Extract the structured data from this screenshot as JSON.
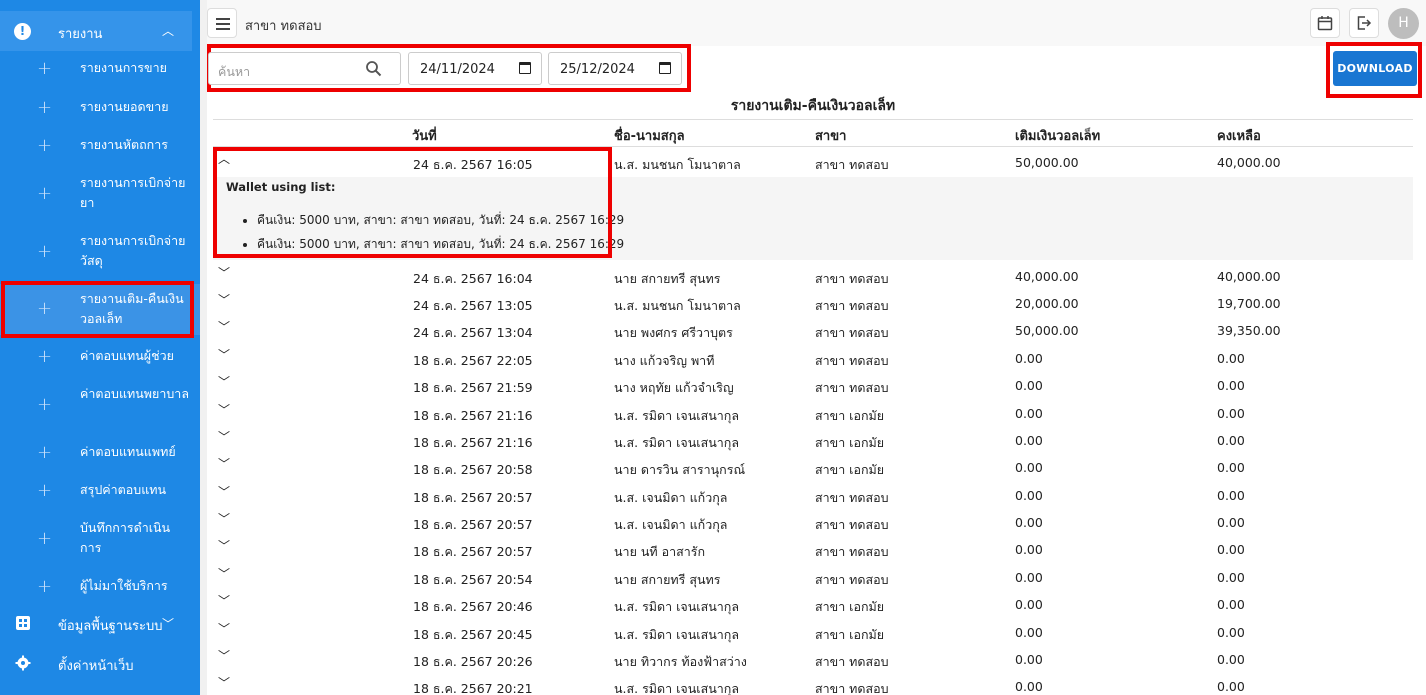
{
  "sidebar": {
    "header_label": "รายงาน",
    "items": [
      {
        "label": "รายงานการขาย"
      },
      {
        "label": "รายงานยอดขาย"
      },
      {
        "label": "รายงานหัตถการ"
      },
      {
        "label": "รายงานการเบิกจ่ายยา"
      },
      {
        "label": "รายงานการเบิกจ่ายวัสดุ"
      },
      {
        "label": "รายงานเติม-คืนเงินวอลเล็ท"
      },
      {
        "label": "ค่าตอบแทนผู้ช่วย"
      },
      {
        "label": "ค่าตอบแทนพยาบาล"
      },
      {
        "label": "ค่าตอบแทนแพทย์"
      },
      {
        "label": "สรุปค่าตอบแทน"
      },
      {
        "label": "บันทึกการดำเนินการ"
      },
      {
        "label": "ผู้ไม่มาใช้บริการ"
      }
    ],
    "bottom": [
      {
        "label": "ข้อมูลพื้นฐานระบบ",
        "icon": "grid-icon"
      },
      {
        "label": "ตั้งค่าหน้าเว็บ",
        "icon": "gear-icon"
      }
    ]
  },
  "header": {
    "branch": "สาขา ทดสอบ",
    "avatar": "H"
  },
  "filters": {
    "search_placeholder": "ค้นหา",
    "date_from": "24/11/2024",
    "date_to": "25/12/2024"
  },
  "download_label": "DOWNLOAD",
  "report": {
    "title": "รายงานเติม-คืนเงินวอลเล็ท",
    "columns": [
      "วันที่",
      "ชื่อ-นามสกุล",
      "สาขา",
      "เติมเงินวอลเล็ท",
      "คงเหลือ"
    ],
    "expanded_row": {
      "date": "24 ธ.ค. 2567 16:05",
      "name": "น.ส. มนชนก โมนาตาล",
      "branch": "สาขา ทดสอบ",
      "topup": "50,000.00",
      "balance": "40,000.00",
      "wallet_title": "Wallet using list:",
      "wallet_items": [
        "คืนเงิน: 5000 บาท, สาขา: สาขา ทดสอบ, วันที่: 24 ธ.ค. 2567 16:29",
        "คืนเงิน: 5000 บาท, สาขา: สาขา ทดสอบ, วันที่: 24 ธ.ค. 2567 16:29"
      ]
    },
    "rows": [
      {
        "date": "24 ธ.ค. 2567 16:04",
        "name": "นาย สกายทรี สุนทร",
        "branch": "สาขา ทดสอบ",
        "topup": "40,000.00",
        "balance": "40,000.00"
      },
      {
        "date": "24 ธ.ค. 2567 13:05",
        "name": "น.ส. มนชนก โมนาตาล",
        "branch": "สาขา ทดสอบ",
        "topup": "20,000.00",
        "balance": "19,700.00"
      },
      {
        "date": "24 ธ.ค. 2567 13:04",
        "name": "นาย พงศกร ศรีวาบุตร",
        "branch": "สาขา ทดสอบ",
        "topup": "50,000.00",
        "balance": "39,350.00"
      },
      {
        "date": "18 ธ.ค. 2567 22:05",
        "name": "นาง แก้วจริญ พาที",
        "branch": "สาขา ทดสอบ",
        "topup": "0.00",
        "balance": "0.00"
      },
      {
        "date": "18 ธ.ค. 2567 21:59",
        "name": "นาง หฤทัย แก้วจำเริญ",
        "branch": "สาขา ทดสอบ",
        "topup": "0.00",
        "balance": "0.00"
      },
      {
        "date": "18 ธ.ค. 2567 21:16",
        "name": "น.ส. รมิดา เจนเสนากุล",
        "branch": "สาขา เอกมัย",
        "topup": "0.00",
        "balance": "0.00"
      },
      {
        "date": "18 ธ.ค. 2567 21:16",
        "name": "น.ส. รมิดา เจนเสนากุล",
        "branch": "สาขา เอกมัย",
        "topup": "0.00",
        "balance": "0.00"
      },
      {
        "date": "18 ธ.ค. 2567 20:58",
        "name": "นาย ดารวิน สารานุกรณ์",
        "branch": "สาขา เอกมัย",
        "topup": "0.00",
        "balance": "0.00"
      },
      {
        "date": "18 ธ.ค. 2567 20:57",
        "name": "น.ส. เจนมิดา แก้วกุล",
        "branch": "สาขา ทดสอบ",
        "topup": "0.00",
        "balance": "0.00"
      },
      {
        "date": "18 ธ.ค. 2567 20:57",
        "name": "น.ส. เจนมิดา แก้วกุล",
        "branch": "สาขา ทดสอบ",
        "topup": "0.00",
        "balance": "0.00"
      },
      {
        "date": "18 ธ.ค. 2567 20:57",
        "name": "นาย นที อาสารัก",
        "branch": "สาขา ทดสอบ",
        "topup": "0.00",
        "balance": "0.00"
      },
      {
        "date": "18 ธ.ค. 2567 20:54",
        "name": "นาย สกายทรี สุนทร",
        "branch": "สาขา ทดสอบ",
        "topup": "0.00",
        "balance": "0.00"
      },
      {
        "date": "18 ธ.ค. 2567 20:46",
        "name": "น.ส. รมิดา เจนเสนากุล",
        "branch": "สาขา เอกมัย",
        "topup": "0.00",
        "balance": "0.00"
      },
      {
        "date": "18 ธ.ค. 2567 20:45",
        "name": "น.ส. รมิดา เจนเสนากุล",
        "branch": "สาขา เอกมัย",
        "topup": "0.00",
        "balance": "0.00"
      },
      {
        "date": "18 ธ.ค. 2567 20:26",
        "name": "นาย ทิวากร ท้องฟ้าสว่าง",
        "branch": "สาขา ทดสอบ",
        "topup": "0.00",
        "balance": "0.00"
      },
      {
        "date": "18 ธ.ค. 2567 20:21",
        "name": "น.ส. รมิดา เจนเสนากุล",
        "branch": "สาขา ทดสอบ",
        "topup": "0.00",
        "balance": "0.00"
      }
    ]
  },
  "colors": {
    "sidebar": "#1e88e5",
    "accent": "#1976d2",
    "highlight": "#ee0000"
  }
}
